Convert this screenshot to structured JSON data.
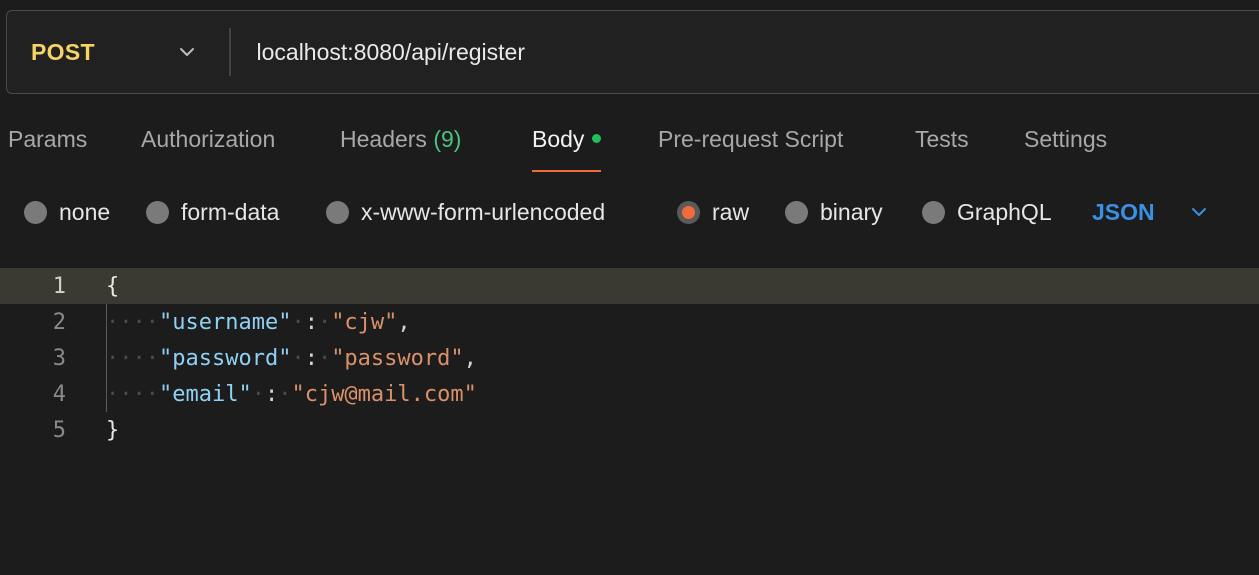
{
  "request": {
    "method": "POST",
    "url": "localhost:8080/api/register"
  },
  "tabs": [
    {
      "label": "Params"
    },
    {
      "label": "Authorization"
    },
    {
      "label": "Headers",
      "count": "(9)"
    },
    {
      "label": "Body",
      "active": true
    },
    {
      "label": "Pre-request Script"
    },
    {
      "label": "Tests"
    },
    {
      "label": "Settings"
    }
  ],
  "body_types": [
    {
      "label": "none"
    },
    {
      "label": "form-data"
    },
    {
      "label": "x-www-form-urlencoded"
    },
    {
      "label": "raw",
      "checked": true
    },
    {
      "label": "binary"
    },
    {
      "label": "GraphQL"
    }
  ],
  "language": "JSON",
  "editor": {
    "line_numbers": [
      "1",
      "2",
      "3",
      "4",
      "5"
    ],
    "lines": {
      "open": "{",
      "username_key": "\"username\"",
      "username_value": "\"cjw\"",
      "password_key": "\"password\"",
      "password_value": "\"password\"",
      "email_key": "\"email\"",
      "email_value": "\"cjw@mail.com\"",
      "close": "}"
    }
  },
  "colors": {
    "method": "#f5d365",
    "accent": "#f26b3a",
    "count": "#4cc07e",
    "language": "#3b8fe5",
    "json_key": "#8fd0f5",
    "json_string": "#d9916a"
  },
  "icons": {
    "method_dropdown": "chevron-down-icon",
    "language_dropdown": "chevron-down-icon",
    "body_indicator": "green-dot-icon"
  }
}
